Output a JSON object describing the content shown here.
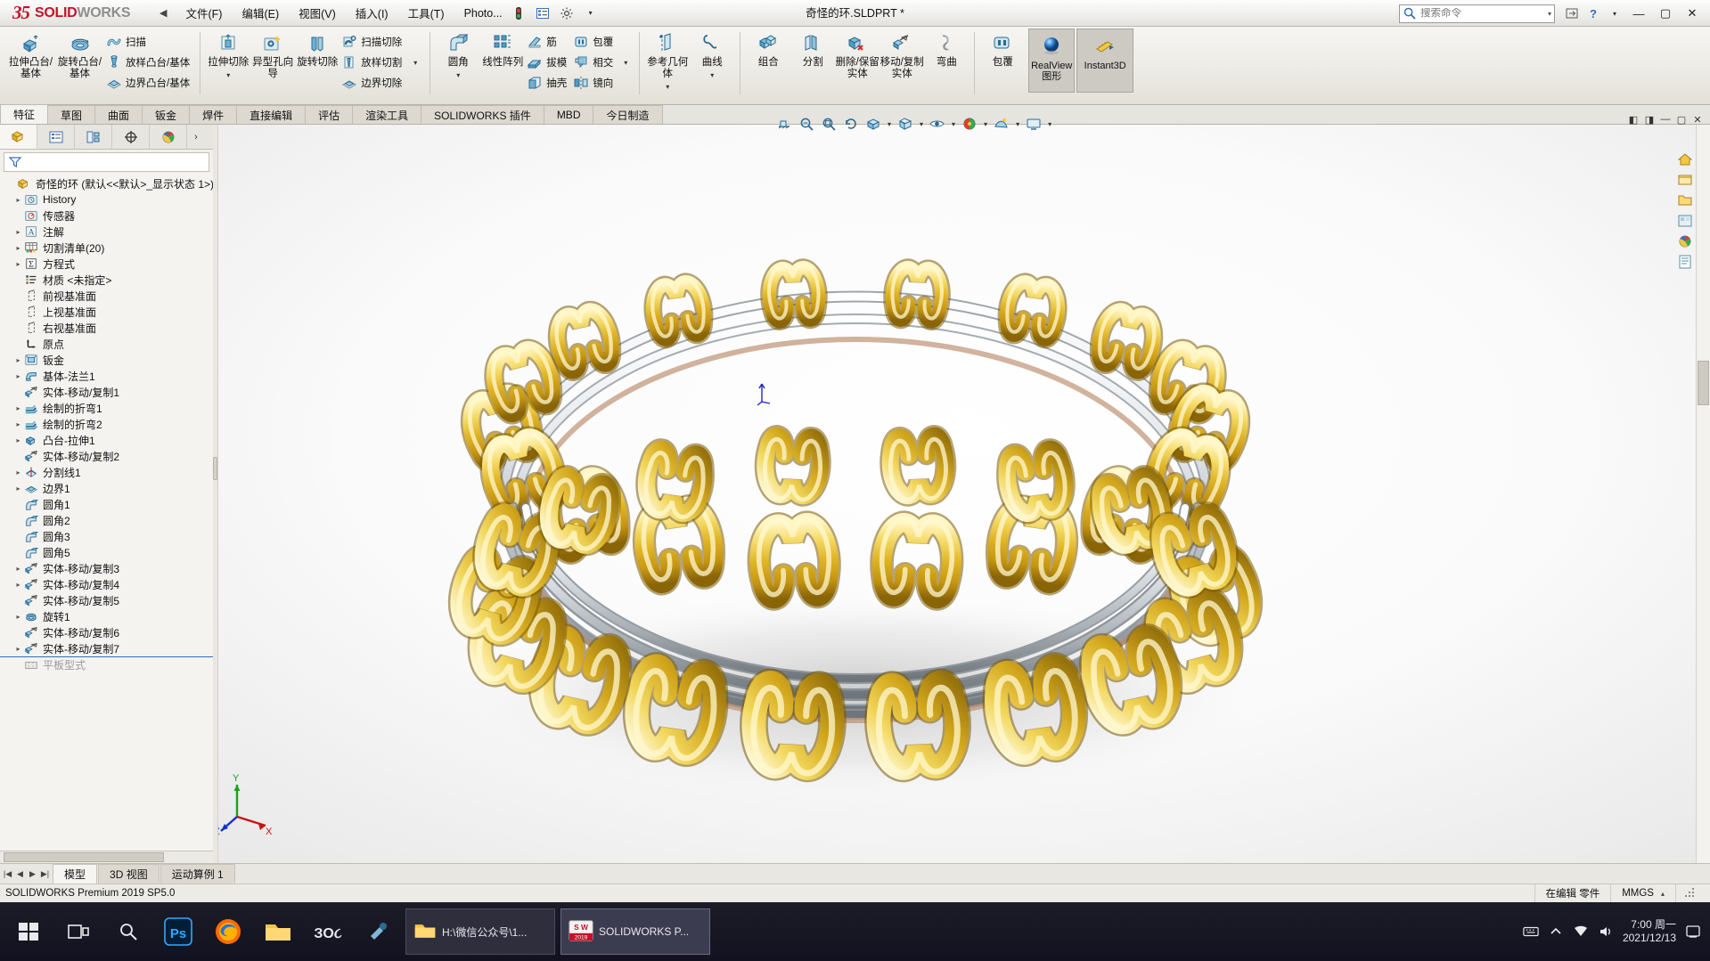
{
  "app": {
    "brand_ds": "35",
    "brand_solid": "SOLID",
    "brand_works": "WORKS",
    "document_title": "奇怪的环.SLDPRT *",
    "version_status": "SOLIDWORKS Premium 2019 SP5.0"
  },
  "menu": {
    "collapse_arrow": "◀",
    "items": [
      {
        "label": "文件(F)"
      },
      {
        "label": "编辑(E)"
      },
      {
        "label": "视图(V)"
      },
      {
        "label": "插入(I)"
      },
      {
        "label": "工具(T)"
      },
      {
        "label": "Photo..."
      }
    ]
  },
  "search": {
    "placeholder": "搜索命令",
    "value": ""
  },
  "titlebar_right": {
    "help": "?",
    "help_caret": "▾",
    "minimize": "—",
    "maximize": "▢",
    "close": "✕"
  },
  "ribbon": {
    "groups": [
      {
        "name": "boss-base",
        "big": [
          {
            "label": "拉伸凸台/基体",
            "icon": "extrude-boss-icon"
          },
          {
            "label": "旋转凸台/基体",
            "icon": "revolve-boss-icon"
          }
        ],
        "small": [
          {
            "label": "扫描",
            "icon": "sweep-icon"
          },
          {
            "label": "放样凸台/基体",
            "icon": "loft-icon"
          },
          {
            "label": "边界凸台/基体",
            "icon": "boundary-boss-icon"
          }
        ]
      },
      {
        "name": "cut",
        "big": [
          {
            "label": "拉伸切除",
            "icon": "extrude-cut-icon"
          },
          {
            "label": "异型孔向导",
            "icon": "hole-wizard-icon"
          },
          {
            "label": "旋转切除",
            "icon": "revolve-cut-icon"
          }
        ],
        "small": [
          {
            "label": "扫描切除",
            "icon": "sweep-cut-icon"
          },
          {
            "label": "放样切割",
            "icon": "loft-cut-icon"
          },
          {
            "label": "边界切除",
            "icon": "boundary-cut-icon"
          }
        ]
      },
      {
        "name": "features",
        "big": [
          {
            "label": "圆角",
            "icon": "fillet-icon"
          },
          {
            "label": "线性阵列",
            "icon": "linear-pattern-icon"
          }
        ],
        "small": [
          {
            "label": "筋",
            "icon": "rib-icon"
          },
          {
            "label": "拔模",
            "icon": "draft-icon"
          },
          {
            "label": "抽壳",
            "icon": "shell-icon"
          },
          {
            "label": "包覆",
            "icon": "wrap-icon"
          },
          {
            "label": "相交",
            "icon": "intersect-icon"
          },
          {
            "label": "镜向",
            "icon": "mirror-icon"
          }
        ]
      },
      {
        "name": "reference",
        "big": [
          {
            "label": "参考几何体",
            "icon": "reference-geometry-icon"
          },
          {
            "label": "曲线",
            "icon": "curves-icon"
          }
        ]
      },
      {
        "name": "bodies",
        "big": [
          {
            "label": "组合",
            "icon": "combine-icon"
          },
          {
            "label": "分割",
            "icon": "split-icon"
          },
          {
            "label": "删除/保留实体",
            "icon": "delete-keep-body-icon"
          },
          {
            "label": "移动/复制实体",
            "icon": "move-copy-body-icon"
          },
          {
            "label": "弯曲",
            "icon": "flex-icon"
          }
        ]
      },
      {
        "name": "display",
        "big": [
          {
            "label": "包覆",
            "icon": "wrap2-icon"
          }
        ],
        "toggles": [
          {
            "label": "RealView 图形",
            "icon": "realview-icon",
            "active": true
          },
          {
            "label": "Instant3D",
            "icon": "instant3d-icon",
            "active": true
          }
        ]
      }
    ]
  },
  "command_tabs": [
    {
      "label": "特征",
      "active": true
    },
    {
      "label": "草图",
      "active": false
    },
    {
      "label": "曲面",
      "active": false
    },
    {
      "label": "钣金",
      "active": false
    },
    {
      "label": "焊件",
      "active": false
    },
    {
      "label": "直接编辑",
      "active": false
    },
    {
      "label": "评估",
      "active": false
    },
    {
      "label": "渲染工具",
      "active": false
    },
    {
      "label": "SOLIDWORKS 插件",
      "active": false
    },
    {
      "label": "MBD",
      "active": false
    },
    {
      "label": "今日制造",
      "active": false
    }
  ],
  "view_toolbar": [
    {
      "name": "section-view-icon"
    },
    {
      "name": "zoom-to-fit-icon"
    },
    {
      "name": "zoom-to-area-icon"
    },
    {
      "name": "previous-view-icon"
    },
    {
      "name": "view-orientation-icon"
    },
    {
      "name": "display-style-icon"
    },
    {
      "name": "hide-show-items-icon"
    },
    {
      "name": "edit-appearance-icon"
    },
    {
      "name": "apply-scene-icon"
    },
    {
      "name": "view-settings-icon"
    }
  ],
  "left_panel": {
    "tabs": [
      {
        "name": "feature-manager-tab",
        "active": true
      },
      {
        "name": "property-manager-tab",
        "active": false
      },
      {
        "name": "configuration-manager-tab",
        "active": false
      },
      {
        "name": "dimxpert-manager-tab",
        "active": false
      },
      {
        "name": "display-manager-tab",
        "active": false
      }
    ],
    "filter_placeholder": "",
    "tree_root": "奇怪的环  (默认<<默认>_显示状态 1>)",
    "tree": [
      {
        "label": "History",
        "indent": 1,
        "expand": true,
        "icon": "history-icon"
      },
      {
        "label": "传感器",
        "indent": 1,
        "expand": false,
        "icon": "sensor-icon"
      },
      {
        "label": "注解",
        "indent": 1,
        "expand": true,
        "icon": "annotations-icon"
      },
      {
        "label": "切割清单(20)",
        "indent": 1,
        "expand": true,
        "icon": "cutlist-icon"
      },
      {
        "label": "方程式",
        "indent": 1,
        "expand": true,
        "icon": "equations-icon"
      },
      {
        "label": "材质 <未指定>",
        "indent": 1,
        "expand": false,
        "icon": "material-icon"
      },
      {
        "label": "前视基准面",
        "indent": 1,
        "expand": false,
        "icon": "plane-icon"
      },
      {
        "label": "上视基准面",
        "indent": 1,
        "expand": false,
        "icon": "plane-icon"
      },
      {
        "label": "右视基准面",
        "indent": 1,
        "expand": false,
        "icon": "plane-icon"
      },
      {
        "label": "原点",
        "indent": 1,
        "expand": false,
        "icon": "origin-icon"
      },
      {
        "label": "钣金",
        "indent": 1,
        "expand": true,
        "icon": "sheetmetal-icon"
      },
      {
        "label": "基体-法兰1",
        "indent": 1,
        "expand": true,
        "icon": "base-flange-icon"
      },
      {
        "label": "实体-移动/复制1",
        "indent": 1,
        "expand": false,
        "icon": "move-copy-icon"
      },
      {
        "label": "绘制的折弯1",
        "indent": 1,
        "expand": true,
        "icon": "sketched-bend-icon"
      },
      {
        "label": "绘制的折弯2",
        "indent": 1,
        "expand": true,
        "icon": "sketched-bend-icon"
      },
      {
        "label": "凸台-拉伸1",
        "indent": 1,
        "expand": true,
        "icon": "boss-extrude-icon"
      },
      {
        "label": "实体-移动/复制2",
        "indent": 1,
        "expand": false,
        "icon": "move-copy-icon"
      },
      {
        "label": "分割线1",
        "indent": 1,
        "expand": true,
        "icon": "split-line-icon"
      },
      {
        "label": "边界1",
        "indent": 1,
        "expand": true,
        "icon": "boundary-icon"
      },
      {
        "label": "圆角1",
        "indent": 1,
        "expand": false,
        "icon": "fillet-tree-icon"
      },
      {
        "label": "圆角2",
        "indent": 1,
        "expand": false,
        "icon": "fillet-tree-icon"
      },
      {
        "label": "圆角3",
        "indent": 1,
        "expand": false,
        "icon": "fillet-tree-icon"
      },
      {
        "label": "圆角5",
        "indent": 1,
        "expand": false,
        "icon": "fillet-tree-icon"
      },
      {
        "label": "实体-移动/复制3",
        "indent": 1,
        "expand": true,
        "icon": "move-copy-icon"
      },
      {
        "label": "实体-移动/复制4",
        "indent": 1,
        "expand": true,
        "icon": "move-copy-icon"
      },
      {
        "label": "实体-移动/复制5",
        "indent": 1,
        "expand": false,
        "icon": "move-copy-icon"
      },
      {
        "label": "旋转1",
        "indent": 1,
        "expand": true,
        "icon": "revolve-tree-icon"
      },
      {
        "label": "实体-移动/复制6",
        "indent": 1,
        "expand": false,
        "icon": "move-copy-icon"
      },
      {
        "label": "实体-移动/复制7",
        "indent": 1,
        "expand": true,
        "icon": "move-copy-icon"
      },
      {
        "label": "平板型式",
        "indent": 1,
        "expand": false,
        "icon": "flat-pattern-icon",
        "dim": true
      }
    ]
  },
  "bottom_tabs": [
    {
      "label": "模型",
      "active": true
    },
    {
      "label": "3D 视图",
      "active": false
    },
    {
      "label": "运动算例 1",
      "active": false
    }
  ],
  "status": {
    "left": "SOLIDWORKS Premium 2019 SP5.0",
    "editing": "在编辑 零件",
    "units": "MMGS",
    "units_caret": "▴"
  },
  "taskbar": {
    "start": "start-icon",
    "pinned": [
      {
        "name": "taskview-icon"
      },
      {
        "name": "search-icon"
      },
      {
        "name": "photoshop-icon",
        "label": "Ps"
      },
      {
        "name": "firefox-icon"
      },
      {
        "name": "explorer-icon"
      },
      {
        "name": "sogou-icon",
        "label": "ЗO૮"
      },
      {
        "name": "tool-icon"
      }
    ],
    "windows": [
      {
        "label": "H:\\微信公众号\\1...",
        "active": false,
        "icon": "folder-icon"
      },
      {
        "label": "SOLIDWORKS P...",
        "active": true,
        "icon": "solidworks-icon"
      }
    ],
    "tray": [
      "keyboard-icon",
      "network-icon",
      "volume-icon",
      "battery-icon"
    ],
    "clock_time": "7:00 周一",
    "clock_date": "2021/12/13"
  },
  "colors": {
    "brand_red": "#c5122b",
    "accent_blue": "#2f6fb5",
    "gold": "#e8c43a",
    "silver": "#c9cdd2"
  }
}
